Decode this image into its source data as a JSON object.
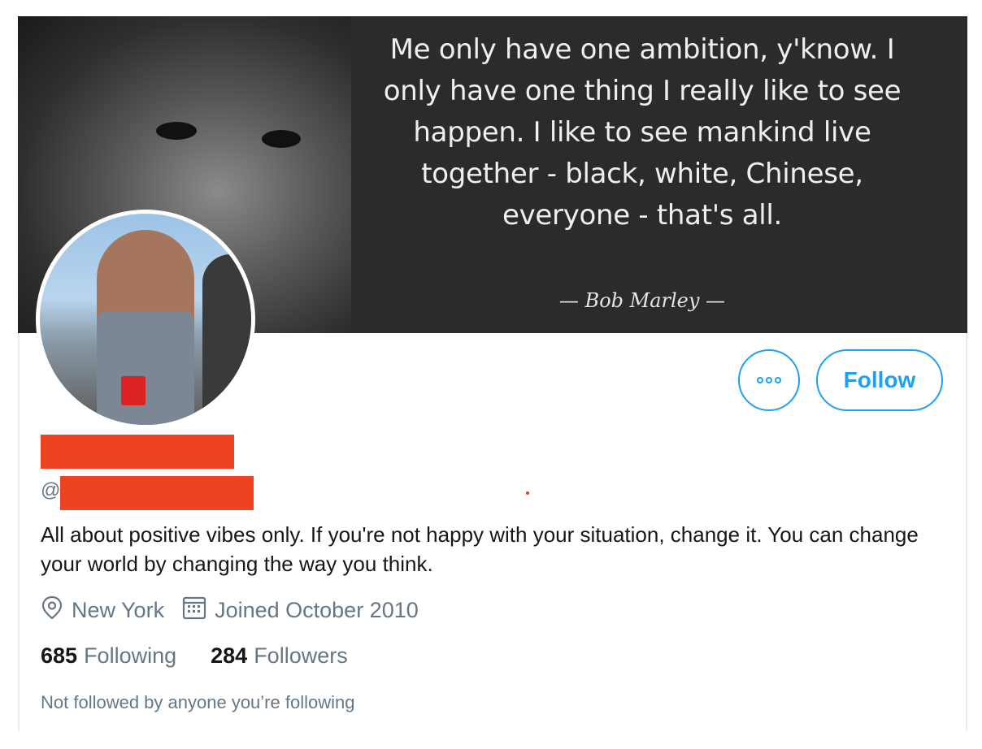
{
  "banner": {
    "quote": "Me only have one ambition, y'know. I only have one thing I really like to see happen. I like to see mankind live together - black, white, Chinese, everyone - that's all.",
    "author": "— Bob Marley —"
  },
  "actions": {
    "more_icon": "more-dots-icon",
    "follow_label": "Follow"
  },
  "profile": {
    "at_symbol": "@",
    "bio": "All about positive vibes only. If you're not happy with your situation, change it. You can change your world by changing the way you think.",
    "location": "New York",
    "joined": "Joined October 2010",
    "following_count": "685",
    "following_label": "Following",
    "followers_count": "284",
    "followers_label": "Followers",
    "not_followed": "Not followed by anyone you’re following"
  },
  "colors": {
    "accent": "#1da1f2",
    "redaction": "#ee4322",
    "muted": "#657786",
    "text": "#14171a"
  }
}
